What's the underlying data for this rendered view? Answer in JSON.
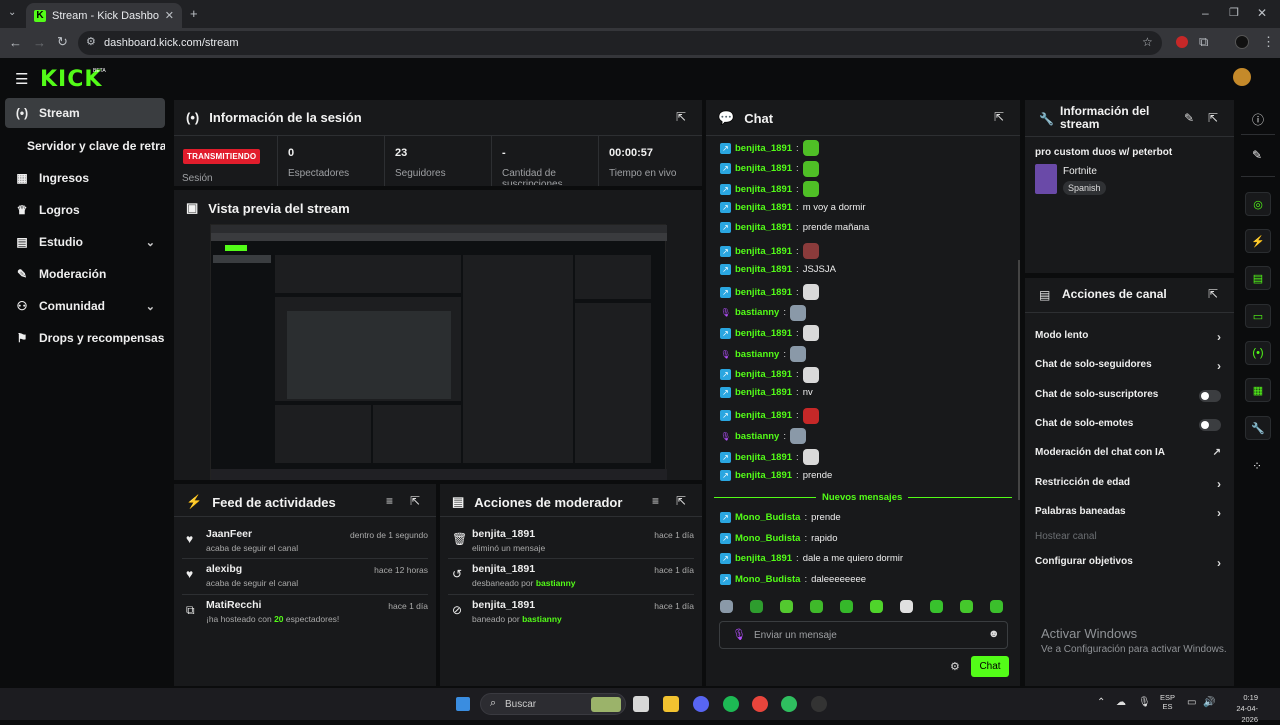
{
  "browser": {
    "tab_title": "Stream - Kick Dashboard",
    "url": "dashboard.kick.com/stream"
  },
  "app": {
    "logo": "KICK",
    "beta": "BETA"
  },
  "sidebar": {
    "items": [
      {
        "label": "Stream",
        "icon": "broadcast-icon"
      },
      {
        "label": "Servidor y clave de retransmisión",
        "icon": ""
      },
      {
        "label": "Ingresos",
        "icon": "dollar-icon"
      },
      {
        "label": "Logros",
        "icon": "trophy-icon"
      },
      {
        "label": "Estudio",
        "icon": "studio-icon"
      },
      {
        "label": "Moderación",
        "icon": "wrench-icon"
      },
      {
        "label": "Comunidad",
        "icon": "community-icon"
      },
      {
        "label": "Drops y recompensas",
        "icon": "gift-icon"
      }
    ]
  },
  "session": {
    "title": "Información de la sesión",
    "status": "TRANSMITIENDO",
    "status_label": "Sesión",
    "stats": [
      {
        "value": "0",
        "label": "Espectadores"
      },
      {
        "value": "23",
        "label": "Seguidores"
      },
      {
        "value": "-",
        "label": "Cantidad de suscripciones"
      },
      {
        "value": "00:00:57",
        "label": "Tiempo en vivo"
      }
    ]
  },
  "preview": {
    "title": "Vista previa del stream"
  },
  "feed": {
    "title": "Feed de actividades",
    "items": [
      {
        "name": "JaanFeer",
        "sub": "acaba de seguir el canal",
        "time": "dentro de 1 segundo",
        "icon": "heart-icon"
      },
      {
        "name": "alexibg",
        "sub": "acaba de seguir el canal",
        "time": "hace 12 horas",
        "icon": "heart-icon"
      },
      {
        "name": "MatiRecchi",
        "sub_pre": "¡ha hosteado con ",
        "sub_num": "20",
        "sub_post": " espectadores!",
        "time": "hace 1 día",
        "icon": "host-icon"
      }
    ]
  },
  "modactions": {
    "title": "Acciones de moderador",
    "items": [
      {
        "name": "benjita_1891",
        "sub": "eliminó un mensaje",
        "time": "hace 1 día",
        "icon": "trash-icon"
      },
      {
        "name": "benjita_1891",
        "sub_pre": "desbaneado por ",
        "sub_user": "bastianny",
        "time": "hace 1 día",
        "icon": "undo-icon"
      },
      {
        "name": "benjita_1891",
        "sub_pre": "baneado por ",
        "sub_user": "bastianny",
        "time": "hace 1 día",
        "icon": "ban-icon"
      }
    ]
  },
  "chat": {
    "title": "Chat",
    "new_messages": "Nuevos mensajes",
    "input_placeholder": "Enviar un mensaje",
    "send_label": "Chat",
    "messages": [
      {
        "user": "benjita_1891",
        "text": "",
        "badge": "b",
        "emote": "#4fbf26"
      },
      {
        "user": "benjita_1891",
        "text": "",
        "badge": "b",
        "emote": "#4fbf26"
      },
      {
        "user": "benjita_1891",
        "text": "",
        "badge": "b",
        "emote": "#4fbf26"
      },
      {
        "user": "benjita_1891",
        "text": "m voy a dormir",
        "badge": "b",
        "emote": ""
      },
      {
        "user": "benjita_1891",
        "text": "prende mañana",
        "badge": "b",
        "emote": ""
      },
      {
        "user": "benjita_1891",
        "text": "",
        "badge": "b",
        "emote": "#8a3b3b"
      },
      {
        "user": "benjita_1891",
        "text": "JSJSJA",
        "badge": "b",
        "emote": ""
      },
      {
        "user": "benjita_1891",
        "text": "",
        "badge": "b",
        "emote": "#d9d9d9"
      },
      {
        "user": "bastianny",
        "text": "",
        "badge": "p",
        "emote": "#8a99a8"
      },
      {
        "user": "benjita_1891",
        "text": "",
        "badge": "b",
        "emote": "#d9d9d9"
      },
      {
        "user": "bastianny",
        "text": "",
        "badge": "p",
        "emote": "#8a99a8"
      },
      {
        "user": "benjita_1891",
        "text": "",
        "badge": "b",
        "emote": "#d9d9d9"
      },
      {
        "user": "benjita_1891",
        "text": "nv",
        "badge": "b",
        "emote": ""
      },
      {
        "user": "benjita_1891",
        "text": "",
        "badge": "b",
        "emote": "#c62828"
      },
      {
        "user": "bastianny",
        "text": "",
        "badge": "p",
        "emote": "#8a99a8"
      },
      {
        "user": "benjita_1891",
        "text": "",
        "badge": "b",
        "emote": "#d9d9d9"
      },
      {
        "user": "benjita_1891",
        "text": "prende",
        "badge": "b",
        "emote": ""
      }
    ],
    "new": [
      {
        "user": "Mono_Budista",
        "text": "prende",
        "badge": "b"
      },
      {
        "user": "Mono_Budista",
        "text": "rapido",
        "badge": "b"
      },
      {
        "user": "benjita_1891",
        "text": "dale a me quiero dormir",
        "badge": "b"
      },
      {
        "user": "Mono_Budista",
        "text": "daleeeeeeee",
        "badge": "b"
      }
    ],
    "emotes": [
      "#8a99a8",
      "#2e9d2e",
      "#53c92f",
      "#3fb92a",
      "#35b82a",
      "#4fd42b",
      "#e0e0e0",
      "#38c22d",
      "#45c82c",
      "#3bbf2c"
    ]
  },
  "streaminfo": {
    "title": "Información del stream",
    "stream_title": "pro custom duos w/ peterbot",
    "category": "Fortnite",
    "language": "Spanish"
  },
  "channel": {
    "title": "Acciones de canal",
    "rows": [
      {
        "label": "Modo lento",
        "type": "arrow"
      },
      {
        "label": "Chat de solo-seguidores",
        "type": "arrow"
      },
      {
        "label": "Chat de solo-suscriptores",
        "type": "toggle"
      },
      {
        "label": "Chat de solo-emotes",
        "type": "toggle"
      },
      {
        "label": "Moderación del chat con IA",
        "type": "ext"
      },
      {
        "label": "Restricción de edad",
        "type": "arrow"
      },
      {
        "label": "Palabras baneadas",
        "type": "arrow"
      },
      {
        "label": "Hostear canal",
        "type": "disabled"
      },
      {
        "label": "Configurar objetivos",
        "type": "arrow"
      }
    ]
  },
  "watermark": {
    "line1": "Activar Windows",
    "line2": "Ve a Configuración para activar Windows."
  },
  "taskbar": {
    "search": "Buscar",
    "lang1": "ESP",
    "lang2": "ES",
    "time": "0:19",
    "date": "24-04-2026"
  }
}
